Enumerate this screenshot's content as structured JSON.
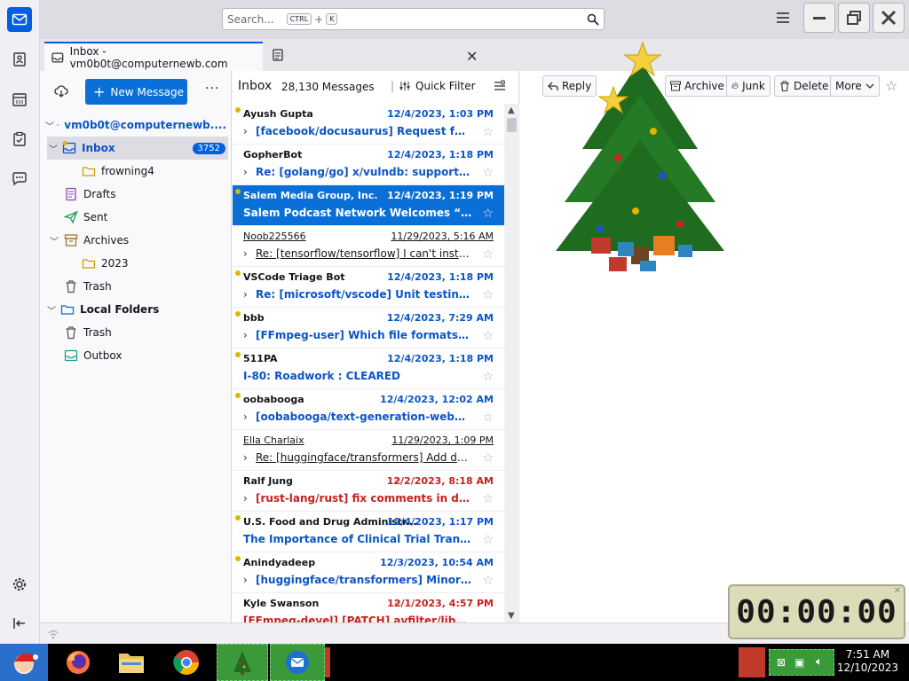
{
  "search": {
    "placeholder": "Search...",
    "kbd1": "CTRL",
    "plus": "+",
    "kbd2": "K"
  },
  "tabs": {
    "inbox_tab": "Inbox - vm0b0t@computernewb.com"
  },
  "folder_pane": {
    "new_message": "New Message",
    "folders": [
      {
        "label": "vm0b0t@computernewb...."
      },
      {
        "label": "Inbox",
        "count": "3752"
      },
      {
        "label": "frowning4"
      },
      {
        "label": "Drafts"
      },
      {
        "label": "Sent"
      },
      {
        "label": "Archives"
      },
      {
        "label": "2023"
      },
      {
        "label": "Trash"
      },
      {
        "label": "Local Folders"
      },
      {
        "label": "Trash"
      },
      {
        "label": "Outbox"
      }
    ]
  },
  "thread_pane": {
    "title": "Inbox",
    "count": "28,130 Messages",
    "quick_filter": "Quick Filter",
    "messages": [
      {
        "from": "Ayush Gupta",
        "date": "12/4/2023, 1:03 PM",
        "subject": "[facebook/docusaurus] Request for C..."
      },
      {
        "from": "GopherBot",
        "date": "12/4/2023, 1:18 PM",
        "subject": "Re: [golang/go] x/vulndb: support C..."
      },
      {
        "from": "Salem Media Group, Inc.",
        "date": "12/4/2023, 1:19 PM",
        "subject": "Salem Podcast Network Welcomes “Ma..."
      },
      {
        "from": "Noob225566",
        "date": "11/29/2023, 5:16 AM",
        "subject": "Re: [tensorflow/tensorflow] I can't install ..."
      },
      {
        "from": "VSCode Triage Bot",
        "date": "12/4/2023, 1:18 PM",
        "subject": "Re: [microsoft/vscode] Unit testing e..."
      },
      {
        "from": "bbb",
        "date": "12/4/2023, 7:29 AM",
        "subject": "[FFmpeg-user] Which file formats ca..."
      },
      {
        "from": "511PA",
        "date": "12/4/2023, 1:18 PM",
        "subject": "I-80: Roadwork : CLEARED"
      },
      {
        "from": "oobabooga",
        "date": "12/4/2023, 12:02 AM",
        "subject": "[oobabooga/text-generation-webui] ..."
      },
      {
        "from": "Ella Charlaix",
        "date": "11/29/2023, 1:09 PM",
        "subject": "Re: [huggingface/transformers] Add de..."
      },
      {
        "from": "Ralf Jung",
        "date": "12/2/2023, 8:18 AM",
        "subject": "[rust-lang/rust] fix comments in dynami..."
      },
      {
        "from": "U.S. Food and Drug Administr...",
        "date": "12/4/2023, 1:17 PM",
        "subject": "The Importance of Clinical Trial Transpa..."
      },
      {
        "from": "Anindyadeep",
        "date": "12/3/2023, 10:54 AM",
        "subject": "[huggingface/transformers] Minor B..."
      },
      {
        "from": "Kyle Swanson",
        "date": "12/1/2023, 4:57 PM",
        "subject": "[FFmpeg-devel] [PATCH] avfilter/libvmaf..."
      }
    ]
  },
  "message_toolbar": {
    "reply": "Reply",
    "archive": "Archive",
    "junk": "Junk",
    "delete": "Delete",
    "more": "More"
  },
  "timer": "00:00:00",
  "clock": {
    "time": "7:51 AM",
    "date": "12/10/2023"
  },
  "colors": {
    "accent": "#0060df",
    "unread": "#0b55c7",
    "hot": "#c5221f",
    "star": "#e0b400"
  }
}
